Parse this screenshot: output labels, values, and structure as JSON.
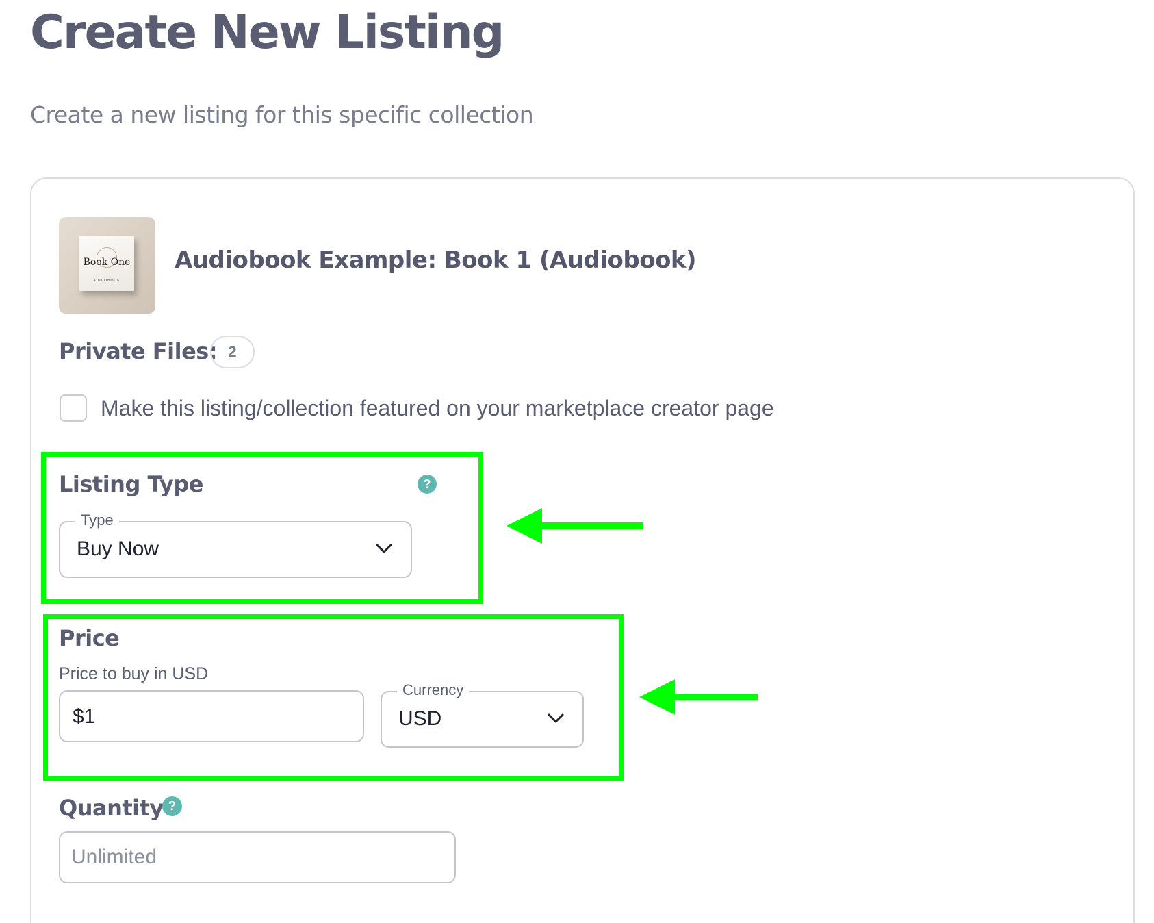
{
  "header": {
    "title": "Create New Listing",
    "subtitle": "Create a new listing for this specific collection"
  },
  "item": {
    "title": "Audiobook Example: Book 1 (Audiobook)",
    "thumbnail_text": "Book One",
    "thumbnail_subtext": "AUDIOBOOK"
  },
  "private_files": {
    "label": "Private Files:",
    "count": "2"
  },
  "featured": {
    "label": "Make this listing/collection featured on your marketplace creator page",
    "checked": false
  },
  "listing_type": {
    "label": "Listing Type",
    "help": "?",
    "field_label": "Type",
    "value": "Buy Now"
  },
  "price": {
    "label": "Price",
    "hint": "Price to buy in USD",
    "value": "$1",
    "currency_label": "Currency",
    "currency_value": "USD"
  },
  "quantity": {
    "label": "Quantity",
    "help": "?",
    "placeholder": "Unlimited"
  },
  "colors": {
    "highlight": "#00ff00",
    "help_icon": "#5fb8b0",
    "text": "#5a5d72"
  }
}
